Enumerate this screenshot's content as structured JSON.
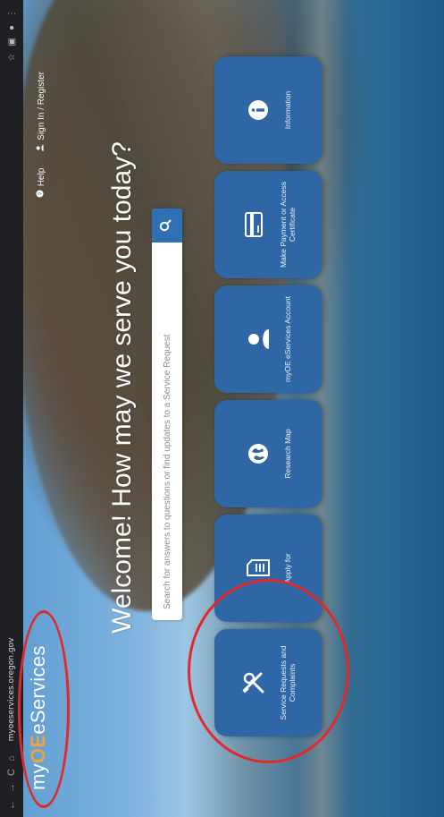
{
  "browser": {
    "url": "myoeservices.oregon.gov",
    "nav_back": "←",
    "nav_forward": "→",
    "nav_reload": "C",
    "nav_home": "⌂"
  },
  "header": {
    "logo_prefix": "my",
    "logo_oe": "OE",
    "logo_suffix": "eServices",
    "nav": [
      {
        "label": "Help",
        "icon": "help-icon"
      },
      {
        "label": "Sign In / Register",
        "icon": "user-icon"
      }
    ]
  },
  "main": {
    "welcome": "Welcome! How may we serve you today?",
    "search": {
      "placeholder": "Search for answers to questions or find updates to a Service Request",
      "icon": "search-icon"
    },
    "tiles": [
      {
        "label": "Service Requests and Complaints",
        "icon": "tools-icon"
      },
      {
        "label": "Apply for",
        "icon": "document-icon"
      },
      {
        "label": "Research Map",
        "icon": "globe-icon"
      },
      {
        "label": "myOE eServices Account",
        "icon": "account-icon"
      },
      {
        "label": "Make Payment or Access Certificate",
        "icon": "payment-card-icon"
      },
      {
        "label": "Information",
        "icon": "info-icon"
      }
    ]
  },
  "colors": {
    "tile": "#2f67a6",
    "accent_orange": "#f2a23a",
    "annotation_red": "#e02a2a"
  }
}
